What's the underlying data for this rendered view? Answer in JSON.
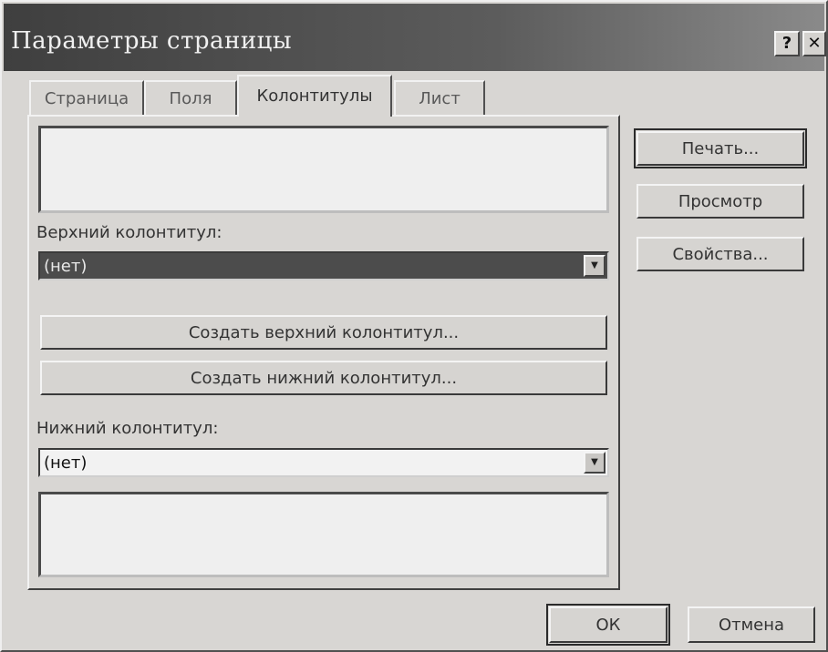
{
  "window": {
    "title": "Параметры страницы",
    "help_label": "?",
    "close_label": "✕"
  },
  "tabs": [
    {
      "label": "Страница",
      "active": false
    },
    {
      "label": "Поля",
      "active": false
    },
    {
      "label": "Колонтитулы",
      "active": true
    },
    {
      "label": "Лист",
      "active": false
    }
  ],
  "header": {
    "label": "Верхний колонтитул:",
    "value": "(нет)",
    "create_label": "Создать верхний колонтитул..."
  },
  "footer": {
    "label": "Нижний колонтитул:",
    "value": "(нет)",
    "create_label": "Создать нижний колонтитул..."
  },
  "side_buttons": {
    "print": "Печать...",
    "preview": "Просмотр",
    "properties": "Свойства..."
  },
  "footer_buttons": {
    "ok": "ОК",
    "cancel": "Отмена"
  }
}
